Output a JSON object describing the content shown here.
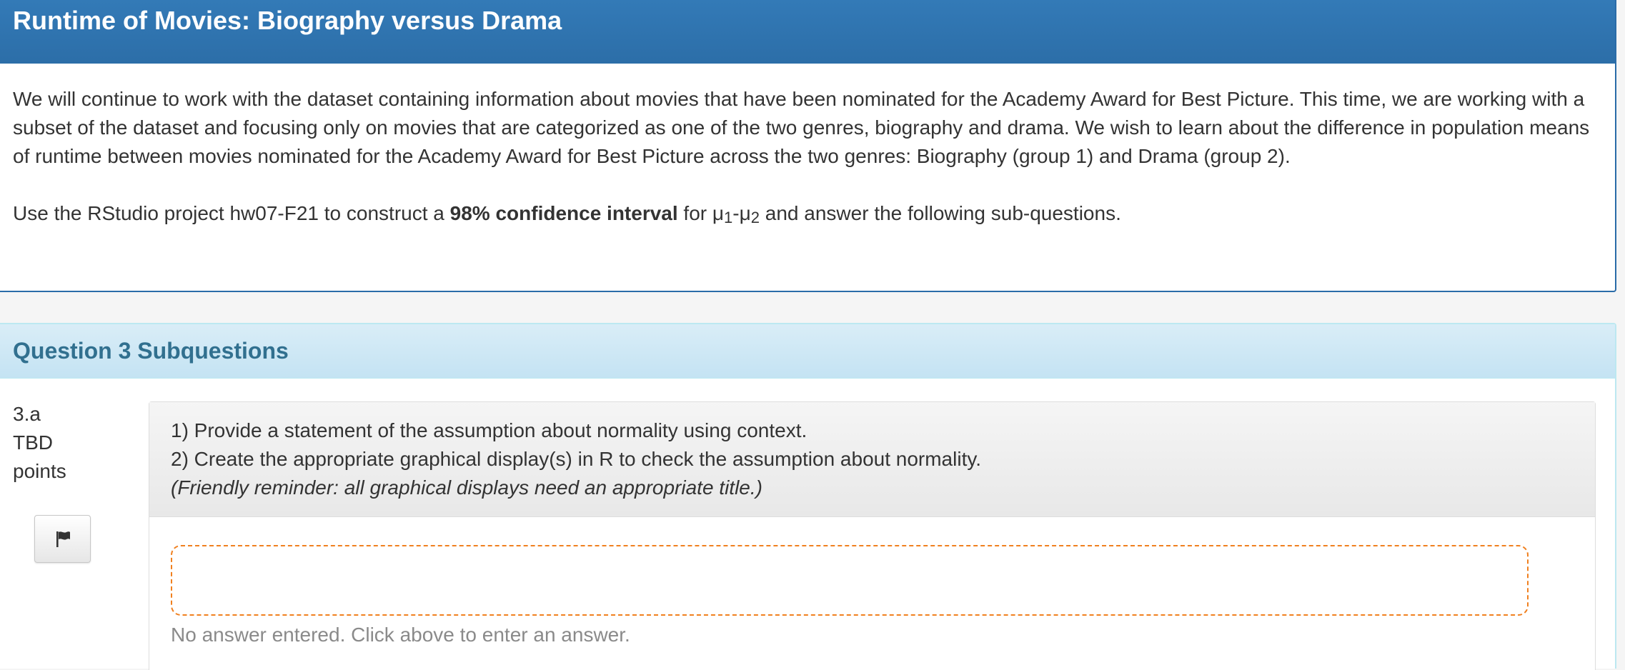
{
  "intro": {
    "title": "Runtime of Movies: Biography versus Drama",
    "paragraph1": "We will continue to work with the dataset containing information about movies that have been nominated for the Academy Award for Best Picture.  This time, we are working with a subset of the dataset and focusing only on movies that are categorized as one of the two genres, biography and drama. We wish to learn about the difference in population means of runtime between movies nominated for the Academy Award for Best Picture across the two genres: Biography (group 1) and Drama (group 2).",
    "paragraph2": {
      "lead": "Use the RStudio project hw07-F21 to construct a ",
      "bold": "98% confidence interval",
      "for_text": " for ",
      "mu": "μ",
      "sub1": "1",
      "dash": "-",
      "sub2": "2",
      "tail": " and answer the following sub-questions."
    }
  },
  "question": {
    "header": "Question 3 Subquestions",
    "number": "3.a",
    "points_value": "TBD",
    "points_label": "points",
    "flag_icon": "flag-icon",
    "prompt_line1": "1) Provide a statement of the assumption about normality using context.",
    "prompt_line2": "2) Create the appropriate graphical display(s) in R to check the assumption about normality.",
    "prompt_line3": "(Friendly reminder: all graphical displays need an appropriate title.)",
    "answer_value": "",
    "no_answer_text": "No answer entered. Click above to enter an answer."
  },
  "colors": {
    "header_blue": "#337ab7",
    "info_header": "#d9edf7",
    "info_text": "#31708f",
    "answer_border": "#f0801f"
  }
}
